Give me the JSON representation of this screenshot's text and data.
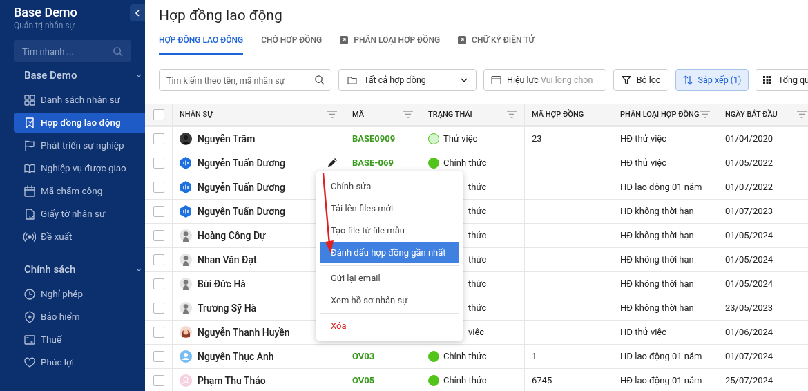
{
  "sidebar": {
    "app_title": "Base Demo",
    "app_subtitle": "Quản trị nhân sự",
    "search_placeholder": "Tìm nhanh ...",
    "sections": [
      {
        "title": "Base Demo",
        "expanded": true,
        "items": [
          {
            "label": "Danh sách nhân sự",
            "selected": false
          },
          {
            "label": "Hợp đồng lao động",
            "selected": true
          },
          {
            "label": "Phát triển sự nghiệp",
            "selected": false
          },
          {
            "label": "Nghiệp vụ được giao",
            "selected": false
          },
          {
            "label": "Mã chấm công",
            "selected": false
          },
          {
            "label": "Giấy tờ nhân sự",
            "selected": false
          },
          {
            "label": "Đề xuất",
            "selected": false
          }
        ]
      },
      {
        "title": "Chính sách",
        "expanded": true,
        "items": [
          {
            "label": "Nghỉ phép",
            "selected": false
          },
          {
            "label": "Bảo hiểm",
            "selected": false
          },
          {
            "label": "Thuế",
            "selected": false
          },
          {
            "label": "Phúc lợi",
            "selected": false
          }
        ]
      }
    ]
  },
  "page_title": "Hợp đồng lao động",
  "tabs": [
    {
      "label": "HỢP ĐỒNG LAO ĐỘNG",
      "external": false,
      "selected": true
    },
    {
      "label": "CHỜ HỢP ĐỒNG",
      "external": false,
      "selected": false
    },
    {
      "label": "PHÂN LOẠI HỢP ĐỒNG",
      "external": true,
      "selected": false
    },
    {
      "label": "CHỮ KÝ ĐIỆN TỬ",
      "external": true,
      "selected": false
    }
  ],
  "toolbar": {
    "search_placeholder": "Tìm kiếm theo tên, mã nhân sự",
    "contract_filter": "Tất cả hợp đồng",
    "validity_label": "Hiệu lực",
    "validity_placeholder": "Vui lòng chọn",
    "filter_button": "Bộ lọc",
    "sort_button": {
      "label": "Sắp xếp (1)",
      "selected": true
    },
    "summary_button": "Tổng qu"
  },
  "table": {
    "all_checked": false,
    "columns": [
      {
        "label": "NHÂN SỰ",
        "filter": true
      },
      {
        "label": "MÃ",
        "filter": true
      },
      {
        "label": "TRẠNG THÁI",
        "filter": true
      },
      {
        "label": "MÃ HỢP ĐỒNG",
        "filter": false
      },
      {
        "label": "PHÂN LOẠI HỢP ĐỒNG",
        "filter": true
      },
      {
        "label": "NGÀY BẮT ĐẦU",
        "filter": true
      }
    ],
    "rows": [
      {
        "checked": false,
        "avatar": {
          "kind": "photo"
        },
        "name": "Nguyễn Trâm",
        "code": "BASE0909",
        "status": {
          "text": "Thử việc",
          "color": "#d4f5cf"
        },
        "contract_no": "23",
        "type": "HĐ thử việc",
        "start": "01/04/2020"
      },
      {
        "checked": false,
        "avatar": {
          "kind": "logo"
        },
        "name": "Nguyễn Tuấn Dương",
        "editing": true,
        "code": "BASE-069",
        "status": {
          "text": "Chính thức",
          "color": "#52c41a"
        },
        "type": "HĐ thử việc",
        "start": "01/05/2022"
      },
      {
        "checked": false,
        "avatar": {
          "kind": "logo"
        },
        "name": "Nguyễn Tuấn Dương",
        "status": {
          "text": "thức"
        },
        "type": "HĐ lao động 01 năm",
        "start": "01/07/2022"
      },
      {
        "checked": false,
        "avatar": {
          "kind": "logo"
        },
        "name": "Nguyễn Tuấn Dương",
        "status": {
          "text": "thức"
        },
        "type": "HĐ không thời hạn",
        "start": "01/07/2023"
      },
      {
        "checked": false,
        "avatar": {
          "kind": "person"
        },
        "name": "Hoàng Công Dự",
        "status": {
          "text": "thức"
        },
        "type": "HĐ không thời hạn",
        "start": "01/05/2024"
      },
      {
        "checked": false,
        "avatar": {
          "kind": "person"
        },
        "name": "Nhan Văn Đạt",
        "status": {
          "text": "thức"
        },
        "type": "HĐ không thời hạn",
        "start": "01/05/2024"
      },
      {
        "checked": false,
        "avatar": {
          "kind": "person"
        },
        "name": "Bùi Đức Hà",
        "status": {
          "text": "thức"
        },
        "type": "HĐ không thời hạn",
        "start": "01/05/2024"
      },
      {
        "checked": false,
        "avatar": {
          "kind": "person"
        },
        "name": "Trương Sỹ Hà",
        "status": {
          "text": "thức"
        },
        "type": "HĐ không thời hạn",
        "start": "23/05/2023"
      },
      {
        "checked": false,
        "avatar": {
          "kind": "illustration"
        },
        "name": "Nguyễn Thanh Huyền",
        "status": {
          "text": "việc"
        },
        "type": "HĐ thử việc",
        "start": "01/06/2024"
      },
      {
        "checked": false,
        "avatar": {
          "kind": "blue"
        },
        "name": "Nguyễn Thục Anh",
        "code": "OV03",
        "status": {
          "text": "Chính thức",
          "color": "#52c41a"
        },
        "contract_no": "1",
        "type": "HĐ lao động 01 năm",
        "start": "01/07/2024"
      },
      {
        "checked": false,
        "avatar": {
          "kind": "pink"
        },
        "name": "Phạm Thu Thảo",
        "code": "OV05",
        "status": {
          "text": "Chính thức",
          "color": "#52c41a"
        },
        "contract_no": "6745",
        "type": "HĐ lao động 01 năm",
        "start": "25/07/2024"
      }
    ]
  },
  "context_menu": [
    {
      "kind": "item",
      "label": "Chỉnh sửa",
      "selected": false
    },
    {
      "kind": "item",
      "label": "Tải lên files mới",
      "selected": false
    },
    {
      "kind": "item",
      "label": "Tạo file từ file mẫu",
      "selected": false
    },
    {
      "kind": "item",
      "label": "Đánh dấu hợp đồng gần nhất",
      "selected": true
    },
    {
      "kind": "divider"
    },
    {
      "kind": "item",
      "label": "Gửi lại email",
      "selected": false
    },
    {
      "kind": "item",
      "label": "Xem hồ sơ nhân sự",
      "selected": false
    },
    {
      "kind": "divider"
    },
    {
      "kind": "danger",
      "label": "Xóa",
      "selected": false
    }
  ],
  "annotation": {
    "kind": "arrow"
  }
}
